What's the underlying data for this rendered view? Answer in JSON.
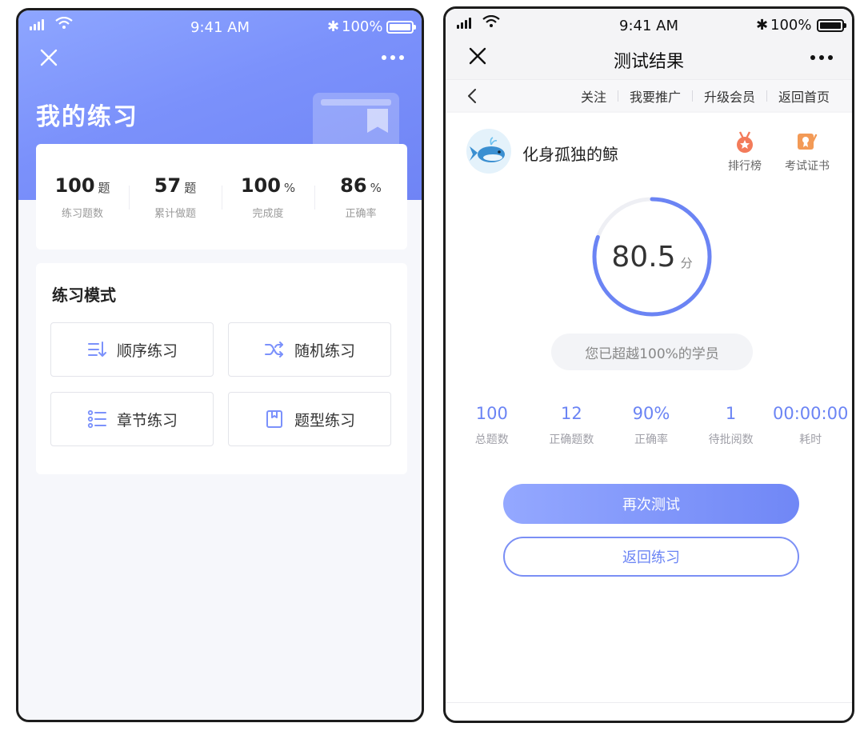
{
  "status_bar": {
    "time": "9:41 AM",
    "battery": "100%"
  },
  "practice_screen": {
    "title": "我的练习",
    "stats": [
      {
        "value": "100",
        "unit": "题",
        "label": "练习题数"
      },
      {
        "value": "57",
        "unit": "题",
        "label": "累计做题"
      },
      {
        "value": "100",
        "unit": "%",
        "label": "完成度"
      },
      {
        "value": "86",
        "unit": "%",
        "label": "正确率"
      }
    ],
    "mode_title": "练习模式",
    "modes": [
      {
        "label": "顺序练习",
        "icon": "sequence-icon"
      },
      {
        "label": "随机练习",
        "icon": "shuffle-icon"
      },
      {
        "label": "章节练习",
        "icon": "chapter-list-icon"
      },
      {
        "label": "题型练习",
        "icon": "bookmark-book-icon"
      }
    ],
    "accent": "#7b91fb"
  },
  "result_screen": {
    "title": "测试结果",
    "nav_links": [
      "关注",
      "我要推广",
      "升级会员",
      "返回首页"
    ],
    "username": "化身孤独的鲸",
    "badges": [
      {
        "label": "排行榜",
        "icon": "medal-icon",
        "color": "#f37b5a"
      },
      {
        "label": "考试证书",
        "icon": "certificate-icon",
        "color": "#f39a56"
      }
    ],
    "score": {
      "value": "80.5",
      "unit": "分",
      "progress": 0.805
    },
    "beat_text": "您已超越100%的学员",
    "stats": [
      {
        "value": "100",
        "label": "总题数"
      },
      {
        "value": "12",
        "label": "正确题数"
      },
      {
        "value": "90%",
        "label": "正确率"
      },
      {
        "value": "1",
        "label": "待批阅数"
      },
      {
        "value": "00:00:00",
        "label": "耗时"
      }
    ],
    "retest_label": "再次测试",
    "back_label": "返回练习",
    "accent": "#6b84f4"
  }
}
